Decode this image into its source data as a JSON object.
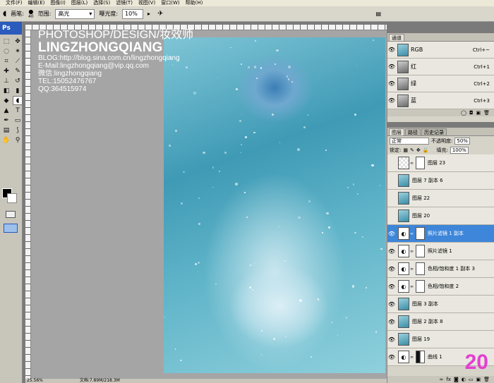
{
  "menubar": {
    "items": [
      "文件(F)",
      "编辑(E)",
      "图像(I)",
      "图层(L)",
      "选择(S)",
      "滤镜(T)",
      "视图(V)",
      "窗口(W)",
      "帮助(H)"
    ]
  },
  "options": {
    "brush_label": "画笔:",
    "brush_size": "40",
    "range_label": "范围:",
    "range_value": "高光",
    "exposure_label": "曝光度:",
    "exposure_value": "10%"
  },
  "toolbox": {
    "header": "Ps"
  },
  "watermark": {
    "title": "PHOTOSHOP/DESIGN/妆效师",
    "name": "LINGZHONGQIANG",
    "blog": "BLOG:http://blog.sina.com.cn/lingzhongqiang",
    "email": "E-Mail:lingzhongqiang@vip.qq.com",
    "weixin": "微信:lingzhongqiang",
    "tel": "TEL:15052476767",
    "qq": "QQ:364515974"
  },
  "channels": {
    "tab": "通道",
    "rows": [
      {
        "name": "RGB",
        "key": "Ctrl+~"
      },
      {
        "name": "红",
        "key": "Ctrl+1"
      },
      {
        "name": "绿",
        "key": "Ctrl+2"
      },
      {
        "name": "蓝",
        "key": "Ctrl+3"
      }
    ]
  },
  "layers": {
    "tabs": [
      "图层",
      "路径",
      "历史记录"
    ],
    "blend_mode": "正常",
    "opacity_label": "不透明度:",
    "opacity": "50%",
    "lock_label": "锁定:",
    "fill_label": "填充:",
    "fill": "100%",
    "rows": [
      {
        "name": "图层 23",
        "visible": false,
        "thumb": "checker",
        "mask": true
      },
      {
        "name": "图层 7 副本 6",
        "visible": false,
        "thumb": "photo"
      },
      {
        "name": "图层 22",
        "visible": false,
        "thumb": "photo"
      },
      {
        "name": "图层 20",
        "visible": false,
        "thumb": "photo"
      },
      {
        "name": "照片滤镜 1 副本",
        "visible": true,
        "thumb": "adj",
        "mask": true,
        "selected": true
      },
      {
        "name": "照片滤镜 1",
        "visible": true,
        "thumb": "adj",
        "mask": true
      },
      {
        "name": "色相/饱和度 1 副本 3",
        "visible": true,
        "thumb": "adj",
        "mask": true
      },
      {
        "name": "色相/饱和度 2",
        "visible": true,
        "thumb": "adj",
        "mask": true
      },
      {
        "name": "图层 3 副本",
        "visible": true,
        "thumb": "photo"
      },
      {
        "name": "图层 2 副本 8",
        "visible": true,
        "thumb": "photo"
      },
      {
        "name": "图层 19",
        "visible": true,
        "thumb": "photo"
      },
      {
        "name": "曲线 1",
        "visible": true,
        "thumb": "adj",
        "mask": true,
        "mask_dark": true
      }
    ]
  },
  "page_number": "20",
  "status": {
    "zoom": "25.56%",
    "doc": "文档:7.89M/218.3M"
  },
  "colors": {
    "selected_layer": "#3d86d9",
    "page_number": "#e33fd0",
    "panel_bg": "#d6d3c9"
  }
}
